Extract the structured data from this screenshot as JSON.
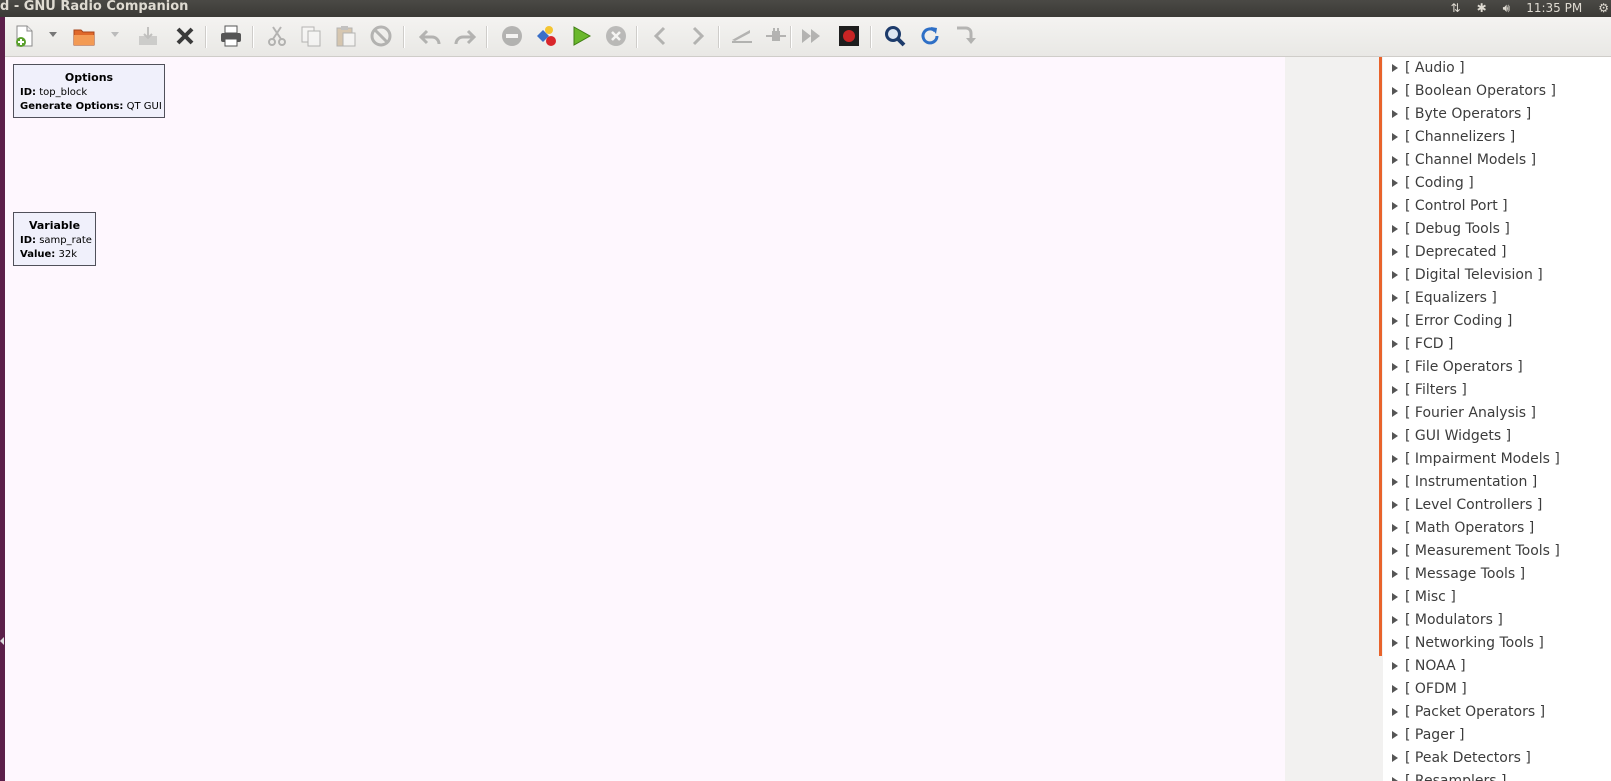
{
  "window": {
    "title": "d - GNU Radio Companion",
    "clock": "11:35 PM"
  },
  "toolbar": {
    "buttons": [
      {
        "name": "new",
        "icon": "new-document-icon"
      },
      {
        "name": "open",
        "icon": "open-folder-icon"
      },
      {
        "name": "save",
        "icon": "save-icon"
      },
      {
        "name": "close",
        "icon": "close-icon"
      },
      {
        "name": "print",
        "icon": "print-icon"
      },
      {
        "name": "cut",
        "icon": "cut-icon"
      },
      {
        "name": "copy",
        "icon": "copy-icon"
      },
      {
        "name": "paste",
        "icon": "paste-icon"
      },
      {
        "name": "delete",
        "icon": "delete-icon"
      },
      {
        "name": "undo",
        "icon": "undo-icon"
      },
      {
        "name": "redo",
        "icon": "redo-icon"
      },
      {
        "name": "disable",
        "icon": "disable-icon"
      },
      {
        "name": "generate",
        "icon": "generate-icon"
      },
      {
        "name": "execute",
        "icon": "play-icon"
      },
      {
        "name": "kill",
        "icon": "stop-icon"
      },
      {
        "name": "rotate-ccw",
        "icon": "chevron-left-icon"
      },
      {
        "name": "rotate-cw",
        "icon": "chevron-right-icon"
      },
      {
        "name": "enable",
        "icon": "enable-icon"
      },
      {
        "name": "disable-block",
        "icon": "plug-icon"
      },
      {
        "name": "bypass",
        "icon": "bypass-icon"
      },
      {
        "name": "screenshot",
        "icon": "record-icon"
      },
      {
        "name": "find",
        "icon": "search-icon"
      },
      {
        "name": "reload",
        "icon": "reload-icon"
      },
      {
        "name": "open-hier",
        "icon": "down-arrow-icon"
      }
    ]
  },
  "canvas": {
    "options_block": {
      "title": "Options",
      "id_label": "ID:",
      "id_value": "top_block",
      "gen_label": "Generate Options:",
      "gen_value": "QT GUI"
    },
    "variable_block": {
      "title": "Variable",
      "id_label": "ID:",
      "id_value": "samp_rate",
      "value_label": "Value:",
      "value_value": "32k"
    }
  },
  "library": {
    "accent_color": "#e8632b",
    "categories": [
      "[ Audio ]",
      "[ Boolean Operators ]",
      "[ Byte Operators ]",
      "[ Channelizers ]",
      "[ Channel Models ]",
      "[ Coding ]",
      "[ Control Port ]",
      "[ Debug Tools ]",
      "[ Deprecated ]",
      "[ Digital Television ]",
      "[ Equalizers ]",
      "[ Error Coding ]",
      "[ FCD ]",
      "[ File Operators ]",
      "[ Filters ]",
      "[ Fourier Analysis ]",
      "[ GUI Widgets ]",
      "[ Impairment Models ]",
      "[ Instrumentation ]",
      "[ Level Controllers ]",
      "[ Math Operators ]",
      "[ Measurement Tools ]",
      "[ Message Tools ]",
      "[ Misc ]",
      "[ Modulators ]",
      "[ Networking Tools ]",
      "[ NOAA ]",
      "[ OFDM ]",
      "[ Packet Operators ]",
      "[ Pager ]",
      "[ Peak Detectors ]",
      "[ Resamplers ]"
    ]
  }
}
